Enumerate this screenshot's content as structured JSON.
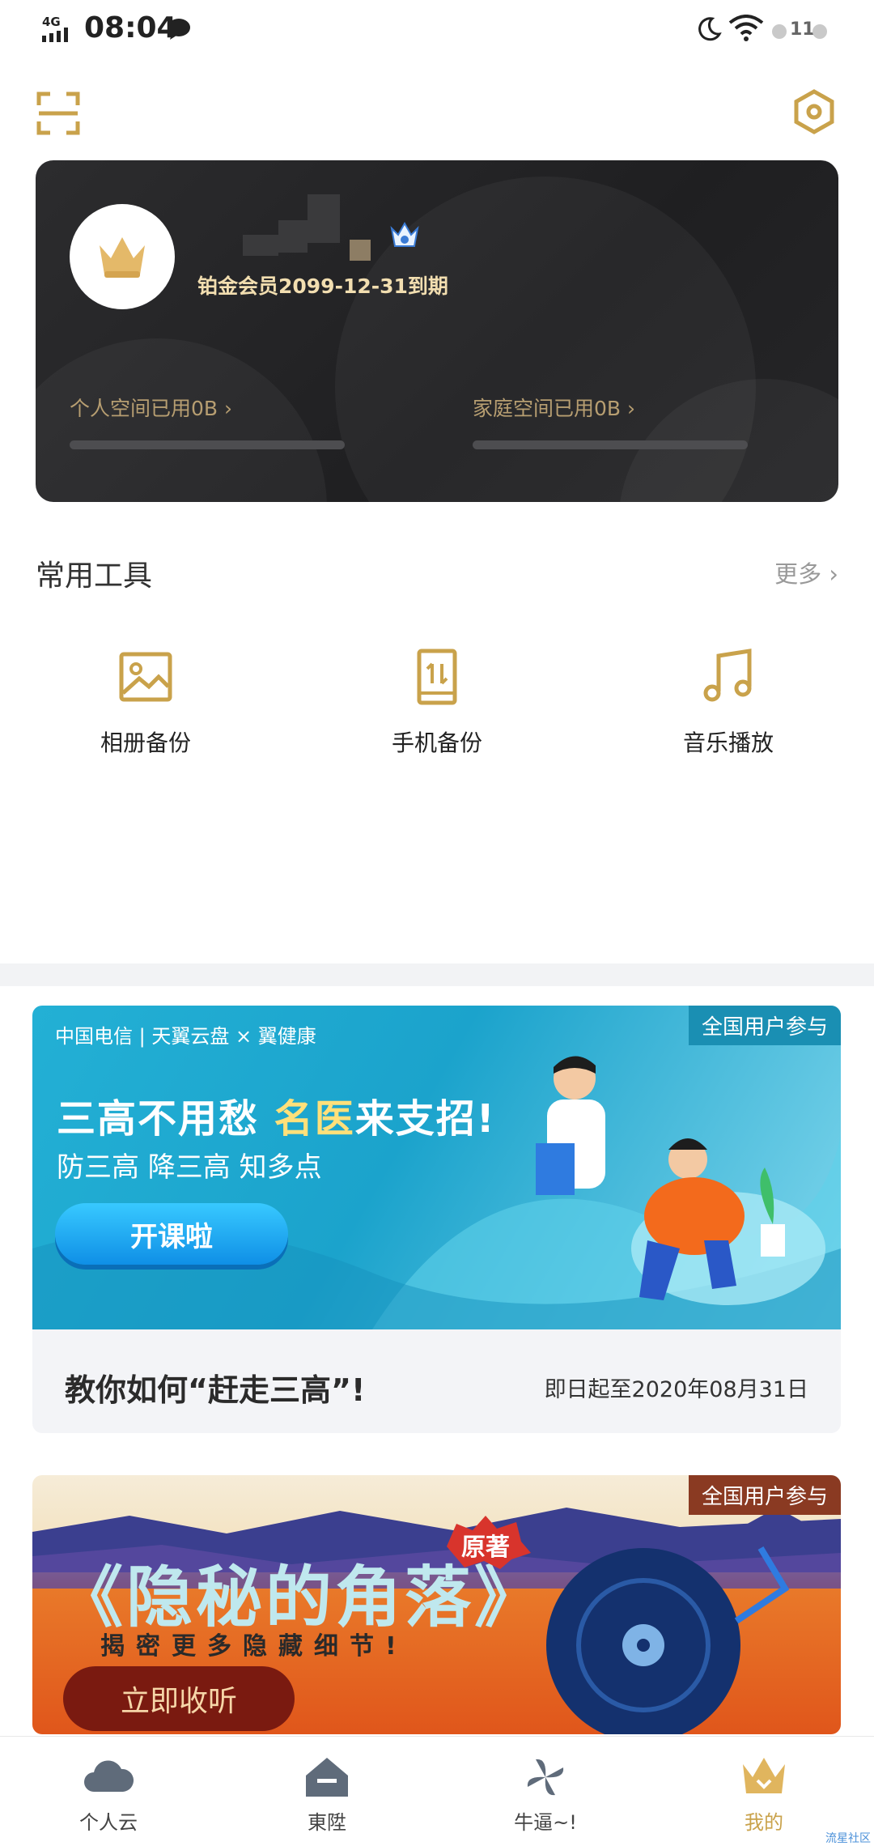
{
  "status_bar": {
    "network": "4G",
    "time": "08:04",
    "battery": "11"
  },
  "member_card": {
    "member_text": "铂金会员2099-12-31到期",
    "personal_space": "个人空间已用0B ›",
    "family_space": "家庭空间已用0B ›"
  },
  "tools": {
    "title": "常用工具",
    "more": "更多 ›",
    "items": [
      {
        "label": "相册备份",
        "icon": "photo-icon"
      },
      {
        "label": "手机备份",
        "icon": "phone-backup-icon"
      },
      {
        "label": "音乐播放",
        "icon": "music-icon"
      }
    ]
  },
  "banner1": {
    "tag": "全国用户参与",
    "logos": "中国电信 | 天翼云盘 × 翼健康",
    "headline_a": "三高不用愁",
    "headline_b": "名医",
    "headline_c": "来支招!",
    "sub": "防三高 降三高 知多点",
    "button": "开课啦",
    "title": "教你如何“赶走三高”!",
    "date": "即日起至2020年08月31日"
  },
  "banner2": {
    "tag": "全国用户参与",
    "title": "《隐秘的角落》",
    "origin": "原著",
    "sub": "揭密更多隐藏细节!",
    "button": "立即收听"
  },
  "tab_bar": {
    "items": [
      {
        "label": "个人云",
        "icon": "cloud-icon"
      },
      {
        "label": "東陞",
        "icon": "home-icon"
      },
      {
        "label": "牛逼~!",
        "icon": "pinwheel-icon"
      },
      {
        "label": "我的",
        "icon": "crown-icon"
      }
    ],
    "active": "我的"
  },
  "watermark": "流星社区",
  "colors": {
    "gold": "#c9a24b",
    "card_bg": "#232325",
    "accent_blue": "#1ba3cc"
  }
}
